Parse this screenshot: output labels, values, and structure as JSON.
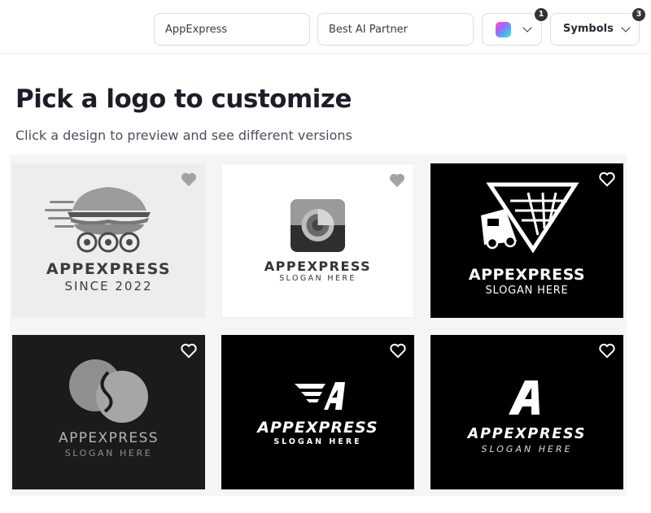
{
  "search": {
    "business_name": "AppExpress",
    "slogan": "Best AI Partner"
  },
  "filters": {
    "color_badge": "1",
    "symbols_label": "Symbols",
    "symbols_badge": "3"
  },
  "page": {
    "title": "Pick a logo to customize",
    "subtitle": "Click a design to preview and see different versions"
  },
  "logos": [
    {
      "name": "APPEXPRESS",
      "slogan": "SINCE 2022",
      "background": "#ededed",
      "icon": "burger-wheels-icon"
    },
    {
      "name": "APPEXPRESS",
      "slogan": "SLOGAN HERE",
      "background": "#ffffff",
      "icon": "camera-lens-icon"
    },
    {
      "name": "APPEXPRESS",
      "slogan": "SLOGAN HERE",
      "background": "#000000",
      "icon": "truck-triangle-icon"
    },
    {
      "name": "APPEXPRESS",
      "slogan": "SLOGAN HERE",
      "background": "#1b1b1b",
      "icon": "overlapping-circles-icon"
    },
    {
      "name": "APPEXPRESS",
      "slogan": "SLOGAN HERE",
      "background": "#000000",
      "icon": "winged-a-icon"
    },
    {
      "name": "APPEXPRESS",
      "slogan": "SLOGAN HERE",
      "background": "#000000",
      "icon": "letter-a-icon"
    }
  ],
  "icons": {
    "favorite": "heart-icon",
    "dropdown": "chevron-down-icon",
    "color_swatch": "gradient-swatch-icon"
  }
}
